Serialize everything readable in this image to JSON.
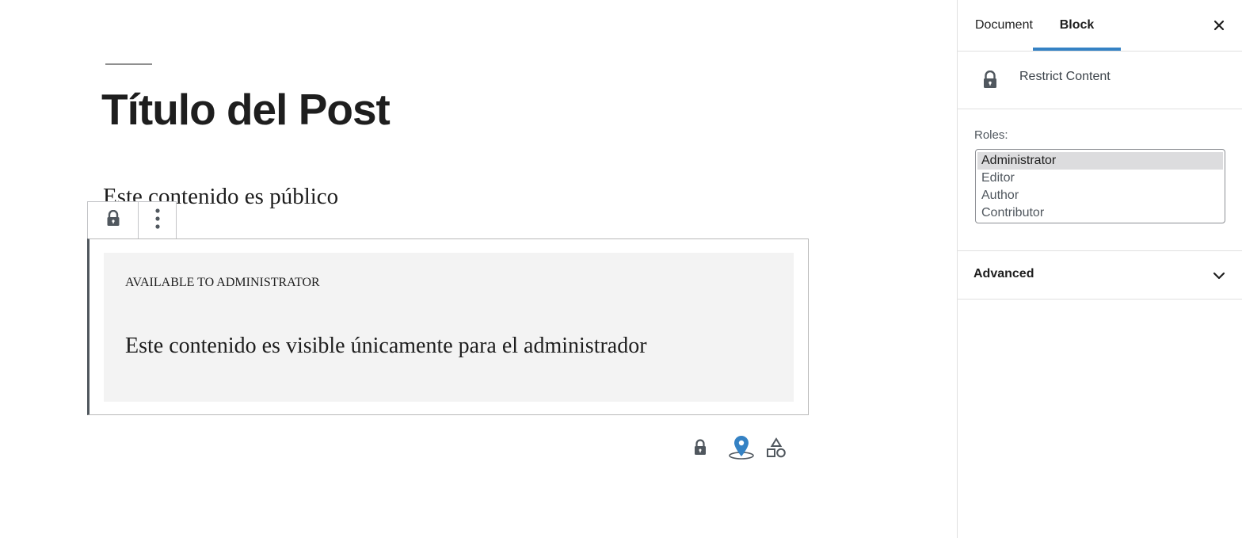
{
  "editor": {
    "post_title": "Título del Post",
    "public_paragraph": "Este contenido es público",
    "block_toolbar": {
      "lock_icon": "lock-icon",
      "more_icon": "more-vertical-icon"
    },
    "restricted_block": {
      "label": "AVAILABLE TO ADMINISTRATOR",
      "content": "Este contenido es visible únicamente para el administrador"
    },
    "bottom_icons": [
      "lock-icon",
      "location-pin-icon",
      "shapes-icon"
    ]
  },
  "sidebar": {
    "tabs": [
      {
        "label": "Document",
        "active": false
      },
      {
        "label": "Block",
        "active": true
      }
    ],
    "close_icon": "close-icon",
    "block_card": {
      "icon": "lock-icon",
      "name": "Restrict Content"
    },
    "roles": {
      "label": "Roles:",
      "options": [
        {
          "label": "Administrator",
          "selected": true
        },
        {
          "label": "Editor",
          "selected": false
        },
        {
          "label": "Author",
          "selected": false
        },
        {
          "label": "Contributor",
          "selected": false
        }
      ]
    },
    "advanced": {
      "label": "Advanced",
      "icon": "chevron-down-icon"
    }
  },
  "colors": {
    "accent": "#3582c4",
    "pin": "#3582c4",
    "text": "#1e1e1e",
    "restricted_bg": "#f3f3f3"
  }
}
